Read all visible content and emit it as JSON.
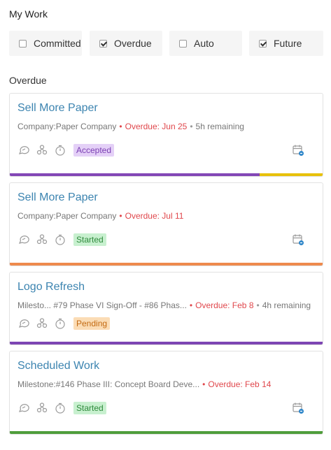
{
  "header": {
    "title": "My Work"
  },
  "filters": [
    {
      "label": "Committed",
      "checked": false
    },
    {
      "label": "Overdue",
      "checked": true
    },
    {
      "label": "Auto",
      "checked": false
    },
    {
      "label": "Future",
      "checked": true
    }
  ],
  "section": {
    "label": "Overdue"
  },
  "cards": [
    {
      "title": "Sell More Paper",
      "context": "Company:Paper Company",
      "overdue": "Overdue: Jun 25",
      "remaining": "5h remaining",
      "status": "Accepted",
      "status_color": "#7b3fb3",
      "bar_colors": [
        "#8347b6",
        "#e8c10b"
      ]
    },
    {
      "title": "Sell More Paper",
      "context": "Company:Paper Company",
      "overdue": "Overdue: Jul 11",
      "status": "Started",
      "status_color": "#2e8a3c",
      "bar_colors": [
        "#ee8a4d"
      ]
    },
    {
      "title": "Logo Refresh",
      "context": "Milesto... #79 Phase VI Sign-Off - #86 Phas...",
      "overdue": "Overdue: Feb 8",
      "remaining": "4h remaining",
      "status": "Pending",
      "status_color": "#c36a12",
      "bar_colors": [
        "#7d45b3"
      ]
    },
    {
      "title": "Scheduled Work",
      "context": "Milestone:#146 Phase III: Concept Board Deve...",
      "overdue": "Overdue: Feb 14",
      "status": "Started",
      "status_color": "#2e8a3c",
      "bar_colors": [
        "#4f9d3b"
      ]
    }
  ]
}
